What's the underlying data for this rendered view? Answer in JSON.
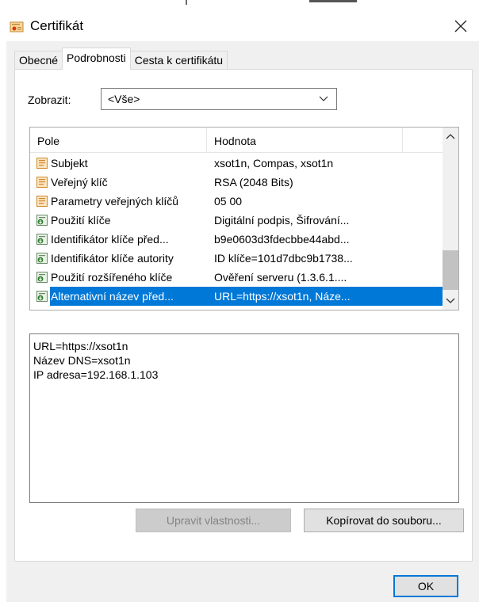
{
  "window": {
    "title": "Certifikát",
    "icon": "certificate-icon"
  },
  "tabs": [
    {
      "label": "Obecné",
      "active": false
    },
    {
      "label": "Podrobnosti",
      "active": true
    },
    {
      "label": "Cesta k certifikátu",
      "active": false
    }
  ],
  "filter": {
    "label": "Zobrazit:",
    "selected": "<Vše>"
  },
  "list": {
    "headers": [
      "Pole",
      "Hodnota"
    ],
    "rows": [
      {
        "field": "Subjekt",
        "value": "xsot1n, Compas, xsot1n",
        "icon": "document-icon",
        "selected": false
      },
      {
        "field": "Veřejný klíč",
        "value": "RSA (2048 Bits)",
        "icon": "document-icon",
        "selected": false
      },
      {
        "field": "Parametry veřejných klíčů",
        "value": "05 00",
        "icon": "document-icon",
        "selected": false
      },
      {
        "field": "Použití klíče",
        "value": "Digitální podpis, Šifrování...",
        "icon": "extension-icon",
        "selected": false
      },
      {
        "field": "Identifikátor klíče před...",
        "value": "b9e0603d3fdecbbe44abd...",
        "icon": "extension-icon",
        "selected": false
      },
      {
        "field": "Identifikátor klíče autority",
        "value": "ID klíče=101d7dbc9b1738...",
        "icon": "extension-icon",
        "selected": false
      },
      {
        "field": "Použití rozšířeného klíče",
        "value": "Ověření serveru (1.3.6.1....",
        "icon": "extension-icon",
        "selected": false
      },
      {
        "field": "Alternativní název před...",
        "value": "URL=https://xsot1n, Náze...",
        "icon": "extension-icon",
        "selected": true
      }
    ]
  },
  "detail": {
    "lines": [
      "URL=https://xsot1n",
      "Název DNS=xsot1n",
      "IP adresa=192.168.1.103"
    ]
  },
  "buttons": {
    "edit": "Upravit vlastnosti...",
    "copy": "Kopírovat do souboru...",
    "ok": "OK"
  },
  "colors": {
    "selection": "#0078d7",
    "dialog_bg": "#f0f0f0",
    "disabled_button": "#cccccc"
  }
}
